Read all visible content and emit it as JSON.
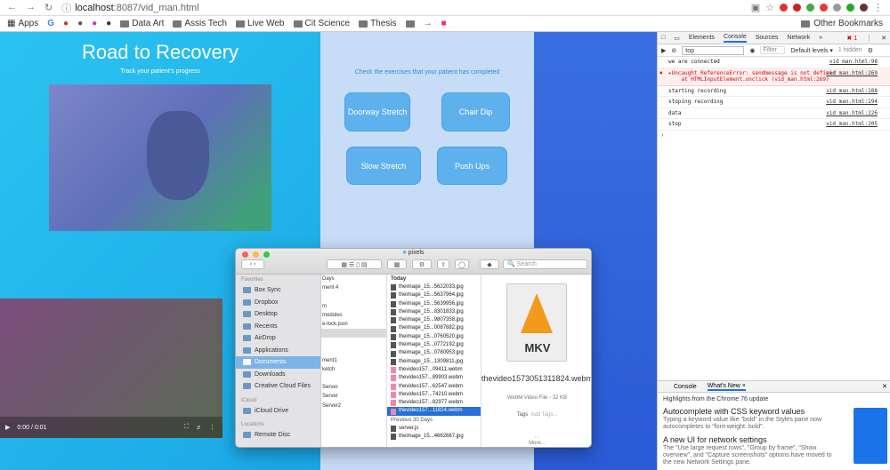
{
  "browser": {
    "url_host": "localhost",
    "url_path": ":8087/vid_man.html",
    "bookmarks": [
      "Apps",
      "Data Art",
      "Assis Tech",
      "Live Web",
      "Cit Science",
      "Thesis"
    ],
    "other_bookmarks": "Other Bookmarks"
  },
  "app": {
    "title": "Road to Recovery",
    "subtitle": "Track your patient's progress",
    "exercise_hint": "Check the exercises that your patient has completed",
    "exercises": [
      "Doorway Stretch",
      "Chair Dip",
      "Slow Stretch",
      "Push Ups"
    ],
    "video_time": "0:00 / 0:01"
  },
  "finder": {
    "title": "pixels",
    "search_placeholder": "Search",
    "sidebar": {
      "favorites_header": "Favorites",
      "favorites": [
        "Box Sync",
        "Dropbox",
        "Desktop",
        "Recents",
        "AirDrop",
        "Applications",
        "Documents",
        "Downloads",
        "Creative Cloud Files"
      ],
      "icloud_header": "iCloud",
      "icloud": [
        "iCloud Drive"
      ],
      "locations_header": "Locations",
      "locations": [
        "Remote Disc"
      ]
    },
    "col1": [
      "Days",
      "ment 4",
      "",
      "m",
      "modules",
      "e-lock.json",
      "",
      "",
      "",
      "ment1",
      "ketch",
      "",
      "Server",
      "Server",
      "Server2"
    ],
    "col2_header": "Today",
    "col2_today": [
      "theimage_15...5622033.jpg",
      "theimage_15...5637964.jpg",
      "theimage_15...5639956.jpg",
      "theimage_15...8301833.jpg",
      "theimage_15...9807358.jpg",
      "theimage_15...0087882.jpg",
      "theimage_15...0760520.jpg",
      "theimage_15...0772192.jpg",
      "theimage_15...0780953.jpg",
      "theimage_15...1309811.jpg",
      "thevideo157...09411.webm",
      "thevideo157...89903.webm",
      "thevideo157...62547.webm",
      "thevideo157...74210.webm",
      "thevideo157...82977.webm",
      "thevideo157...11824.webm"
    ],
    "col2_prev_header": "Previous 30 Days",
    "col2_prev": [
      "server.js",
      "theimage_15...4662667.jpg"
    ],
    "preview": {
      "badge": "MKV",
      "name": "thevideo1573051311824.webm",
      "kind": "WebM Video File - 32 KB",
      "tags_label": "Tags",
      "tags_placeholder": "Add Tags...",
      "more": "More..."
    }
  },
  "devtools": {
    "tabs": [
      "Elements",
      "Console",
      "Sources",
      "Network"
    ],
    "error_count": "1",
    "context": "top",
    "filter": "Filter",
    "levels": "Default levels ▾",
    "hidden": "1 hidden",
    "logs": [
      {
        "text": "we are connected",
        "src": "vid_man.html:98",
        "err": false
      },
      {
        "text": "▸Uncaught ReferenceError: sendmessage is not defined\n    at HTMLInputElement.onclick (vid_man.html:269)",
        "src": "vid_man.html:269",
        "err": true
      },
      {
        "text": "starting recording",
        "src": "vid_man.html:188",
        "err": false
      },
      {
        "text": "stoping recording",
        "src": "vid_man.html:194",
        "err": false
      },
      {
        "text": "data",
        "src": "vid_man.html:226",
        "err": false
      },
      {
        "text": "stop",
        "src": "vid_man.html:205",
        "err": false
      }
    ],
    "drawer_tabs": [
      "Console",
      "What's New ×"
    ],
    "drawer_intro": "Highlights from the Chrome 76 update",
    "items": [
      {
        "h": "Autocomplete with CSS keyword values",
        "p": "Typing a keyword value like \"bold\" in the Styles pane now autocompletes to \"font-weight: bold\"."
      },
      {
        "h": "A new UI for network settings",
        "p": "The \"Use large request rows\", \"Group by frame\", \"Show overview\", and \"Capture screenshots\" options have moved to the new Network Settings pane."
      }
    ]
  }
}
